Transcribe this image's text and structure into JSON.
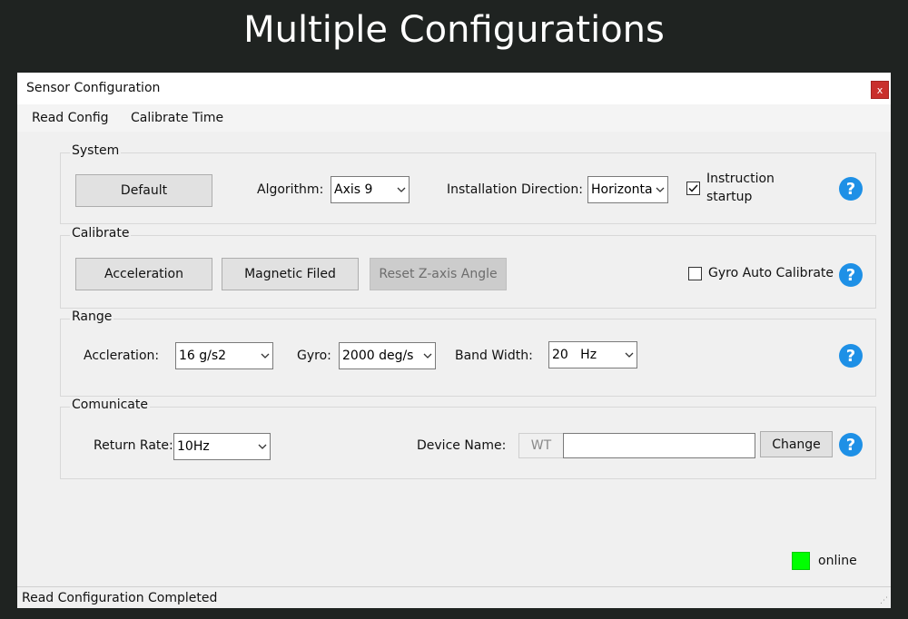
{
  "banner": {
    "title": "Multiple Configurations"
  },
  "window": {
    "title": "Sensor Configuration",
    "close_label": "x"
  },
  "menu": {
    "items": [
      "Read Config",
      "Calibrate Time"
    ]
  },
  "system": {
    "title": "System",
    "default_button": "Default",
    "algorithm_label": "Algorithm:",
    "algorithm_value": "Axis 9",
    "installation_label": "Installation Direction:",
    "installation_value": "Horizontal",
    "instruction_label_line1": "Instruction",
    "instruction_label_line2": "startup",
    "instruction_checked": "☑"
  },
  "calibrate": {
    "title": "Calibrate",
    "acceleration_button": "Acceleration",
    "magnetic_button": "Magnetic Filed",
    "reset_button": "Reset Z-axis Angle",
    "gyro_label": "Gyro Auto Calibrate"
  },
  "range": {
    "title": "Range",
    "acceleration_label": "Accleration:",
    "acceleration_value": "16 g/s2",
    "gyro_label": "Gyro:",
    "gyro_value": "2000 deg/s",
    "bandwidth_label": "Band Width:",
    "bandwidth_value": "20   Hz"
  },
  "communicate": {
    "title": "Comunicate",
    "return_rate_label": "Return Rate:",
    "return_rate_value": "10Hz",
    "device_name_label": "Device Name:",
    "device_prefix": "WT",
    "device_name_value": "",
    "change_button": "Change"
  },
  "status": {
    "online_label": "online",
    "message": "Read Configuration Completed"
  },
  "icons": {
    "help": "?",
    "chevron": "⌵",
    "grip": "⋰"
  },
  "colors": {
    "online": "#00ff00",
    "help": "#1e90e6",
    "close": "#c9302c"
  }
}
